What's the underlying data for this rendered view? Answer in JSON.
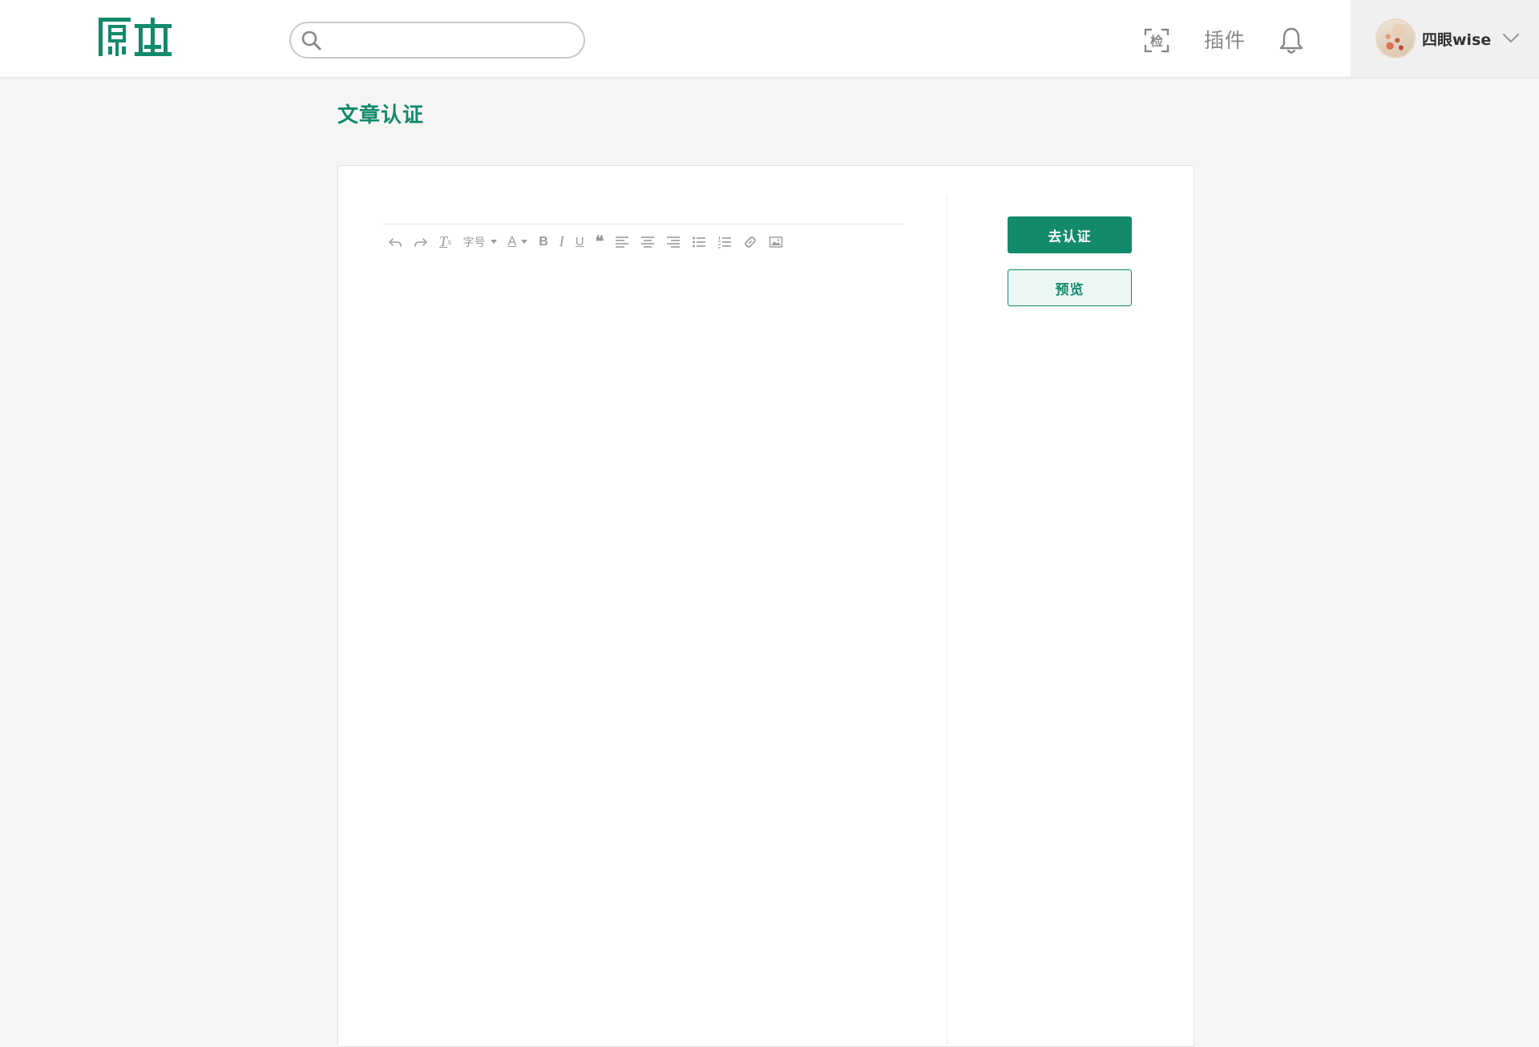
{
  "header": {
    "logo_text": "原本",
    "search": {
      "value": "",
      "placeholder": ""
    },
    "nav": {
      "scan_label": "检",
      "plugin_label": "插件"
    },
    "user": {
      "name": "四眼wise"
    }
  },
  "page": {
    "title": "文章认证"
  },
  "editor": {
    "toolbar": {
      "undo_icon": "undo-icon",
      "redo_icon": "redo-icon",
      "clear_format_label": "T",
      "font_size_label": "字号",
      "font_color_label": "A",
      "bold_label": "B",
      "italic_label": "I",
      "underline_label": "U",
      "quote_label": "❝"
    },
    "content": ""
  },
  "actions": {
    "certify_label": "去认证",
    "preview_label": "预览"
  },
  "colors": {
    "brand": "#128a6b",
    "preview_bg": "#ecf7f4",
    "page_bg": "#f5f5f4"
  }
}
